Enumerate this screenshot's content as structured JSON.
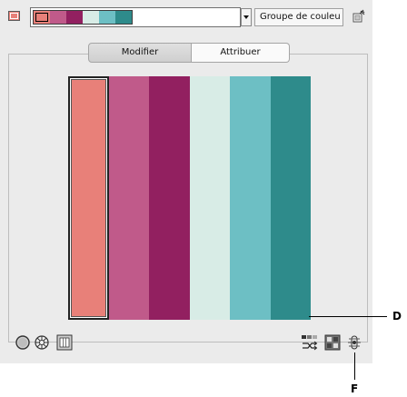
{
  "top_bar": {
    "foreground_color": "#e88079",
    "group_colors": [
      "#e88079",
      "#c05a8a",
      "#922060",
      "#d8ece6",
      "#6dbfc4",
      "#2e8b8b"
    ],
    "group_name": "Groupe de couleu"
  },
  "tabs": [
    {
      "label": "Modifier"
    },
    {
      "label": "Attribuer"
    }
  ],
  "group_colors_panel": [
    "#e88079",
    "#c05a8a",
    "#922060",
    "#d8ece6",
    "#6dbfc4",
    "#2e8b8b"
  ],
  "icons": {
    "bottom_left": [
      "circle-icon",
      "color-wheel-icon",
      "bars-icon"
    ],
    "bottom_right": [
      "shuffle-icon",
      "swap-icon",
      "settings-icon"
    ],
    "top_right": "save-group-icon"
  },
  "callouts": {
    "d": "D",
    "f": "F"
  }
}
